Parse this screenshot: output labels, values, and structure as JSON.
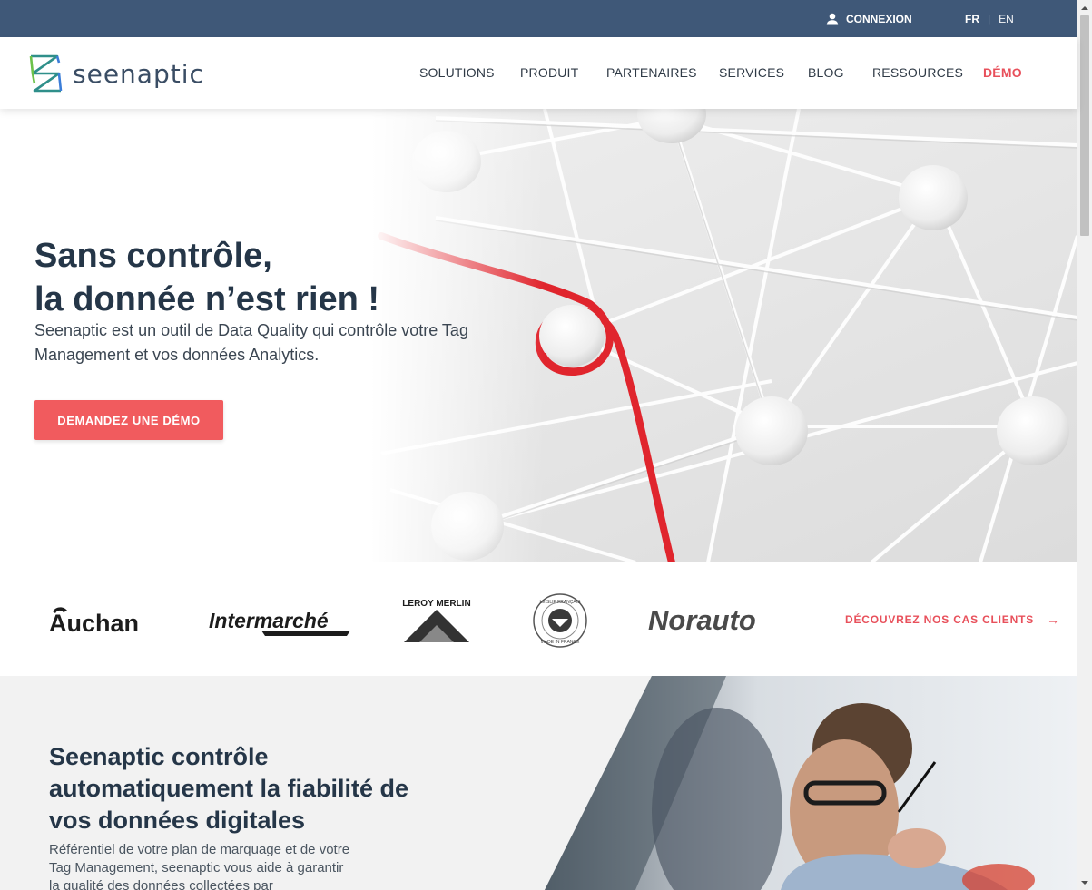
{
  "topbar": {
    "login_label": "CONNEXION",
    "lang_active": "FR",
    "lang_separator": "|",
    "lang_other": "EN"
  },
  "header": {
    "logo_text": "seenaptic",
    "nav": [
      {
        "label": "SOLUTIONS"
      },
      {
        "label": "PRODUIT"
      },
      {
        "label": "PARTENAIRES"
      },
      {
        "label": "SERVICES"
      },
      {
        "label": "BLOG"
      },
      {
        "label": "RESSOURCES"
      },
      {
        "label": "DÉMO"
      }
    ]
  },
  "hero": {
    "title_line1": "Sans contrôle,",
    "title_line2": "la donnée n’est rien !",
    "subtitle": "Seenaptic est un outil de Data Quality qui contrôle votre Tag Management et vos données Analytics.",
    "cta_label": "DEMANDEZ UNE DÉMO"
  },
  "clients": {
    "logos": [
      {
        "name": "Auchan"
      },
      {
        "name": "Intermarché"
      },
      {
        "name": "LEROY MERLIN"
      },
      {
        "name": "LE SLIP FRANÇAIS",
        "sub": "MADE IN FRANCE"
      },
      {
        "name": "Norauto"
      }
    ],
    "cases_link": "DÉCOUVREZ NOS CAS CLIENTS",
    "cases_arrow": "→"
  },
  "feature": {
    "title_line1": "Seenaptic contrôle",
    "title_line2": "automatiquement la fiabilité de",
    "title_line3": "vos données digitales",
    "text": "Référentiel de votre plan de marquage et de votre Tag Management, seenaptic vous aide à garantir la qualité des données collectées par"
  },
  "colors": {
    "topbar": "#3f5878",
    "accent": "#f15b5e",
    "heading": "#253648",
    "feature_bg": "#f2f2f2"
  },
  "icons": {
    "login": "user-icon",
    "arrow": "arrow-right-icon"
  }
}
